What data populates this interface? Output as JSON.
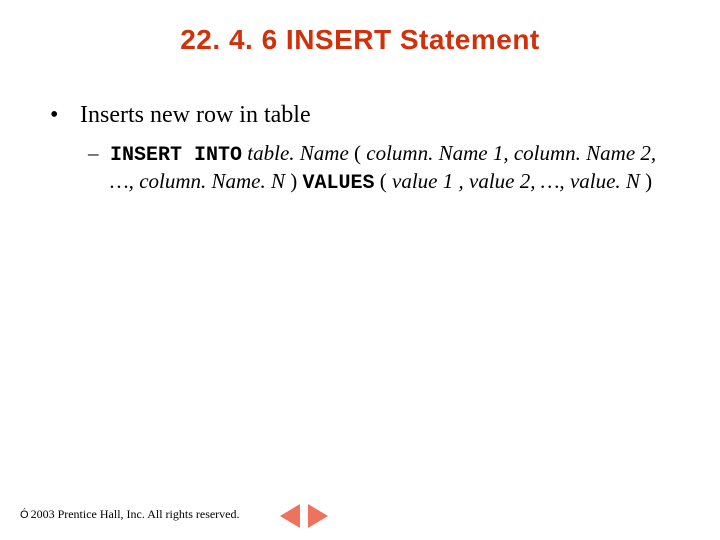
{
  "title": "22. 4. 6 INSERT Statement",
  "body": {
    "lvl1": {
      "bullet": "•",
      "text": "Inserts new row in table"
    },
    "lvl2": {
      "dash": "–",
      "kw_insert_into": "INSERT INTO",
      "table_name": "table. Name",
      "open_paren": " ( ",
      "col1": "column. Name 1",
      "sep1": ", ",
      "col2": "column. Name 2",
      "sep2": ", …, ",
      "colN": "column. Name. N",
      "close_paren1": " ) ",
      "kw_values": "VALUES",
      "open_paren2": " ( ",
      "val1": "value 1",
      "sep3": " , ",
      "val2": "value 2",
      "sep4": ", …, ",
      "valN": "value. N",
      "close_paren2": " )"
    }
  },
  "footer": {
    "copyright_symbol": "Ó",
    "text": " 2003 Prentice Hall, Inc. All rights reserved."
  },
  "colors": {
    "title": "#d0300a",
    "nav": "#ee735f"
  }
}
